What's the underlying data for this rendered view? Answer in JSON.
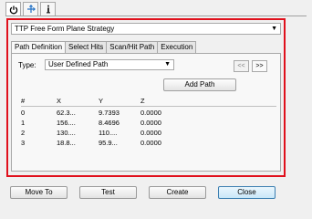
{
  "header_tabs": [
    {
      "icon": "power-icon"
    },
    {
      "icon": "axes-icon"
    },
    {
      "icon": "info-icon"
    }
  ],
  "strategy": {
    "value": "TTP Free Form Plane Strategy"
  },
  "tabs": [
    {
      "label": "Path Definition",
      "active": true
    },
    {
      "label": "Select Hits",
      "active": false
    },
    {
      "label": "Scan/Hit Path",
      "active": false
    },
    {
      "label": "Execution",
      "active": false
    }
  ],
  "type": {
    "label": "Type:",
    "value": "User Defined Path"
  },
  "nav": {
    "prev": "<<",
    "next": ">>"
  },
  "add_path_label": "Add Path",
  "table": {
    "headers": [
      "#",
      "X",
      "Y",
      "Z"
    ],
    "rows": [
      [
        "0",
        "62.3...",
        "9.7393",
        "0.0000"
      ],
      [
        "1",
        "156....",
        "8.4696",
        "0.0000"
      ],
      [
        "2",
        "130....",
        "110....",
        "0.0000"
      ],
      [
        "3",
        "18.8...",
        "95.9...",
        "0.0000"
      ]
    ]
  },
  "buttons": {
    "move_to": "Move To",
    "test": "Test",
    "create": "Create",
    "close": "Close"
  },
  "colors": {
    "highlight_frame": "#e0101c",
    "default_button_border": "#3c7fb1"
  }
}
